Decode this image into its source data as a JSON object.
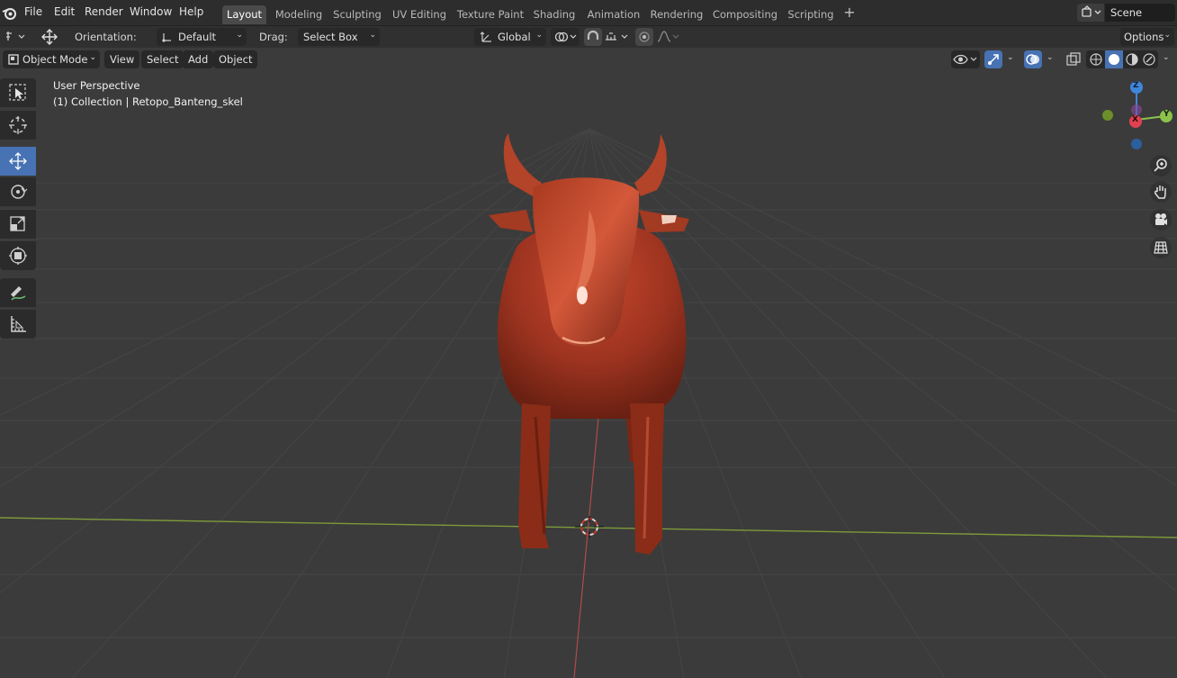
{
  "menu": {
    "items": [
      "File",
      "Edit",
      "Render",
      "Window",
      "Help"
    ]
  },
  "workspaces": {
    "tabs": [
      "Layout",
      "Modeling",
      "Sculpting",
      "UV Editing",
      "Texture Paint",
      "Shading",
      "Animation",
      "Rendering",
      "Compositing",
      "Scripting"
    ],
    "active": "Layout",
    "add_label": "+"
  },
  "scene": {
    "name": "Scene"
  },
  "tool_header": {
    "orientation_label": "Orientation:",
    "orientation_value": "Default",
    "drag_label": "Drag:",
    "drag_value": "Select Box",
    "transform_space": "Global",
    "options_label": "Options"
  },
  "view_header": {
    "mode": "Object Mode",
    "menus": [
      "View",
      "Select",
      "Add",
      "Object"
    ]
  },
  "viewport": {
    "perspective_label": "User Perspective",
    "collection_label": "(1) Collection | Retopo_Banteng_skel"
  },
  "gizmo": {
    "z_label": "Z",
    "y_label": "Y",
    "x_label": "X"
  },
  "tools": [
    "select-box-icon",
    "cursor-icon",
    "move-icon",
    "rotate-icon",
    "scale-icon",
    "transform-icon",
    "annotate-icon",
    "measure-icon"
  ],
  "colors": {
    "accent": "#4772b3",
    "object": "#b03a22",
    "x_axis": "#e04050",
    "y_axis": "#8bc34a",
    "z_axis": "#3f86d9"
  }
}
